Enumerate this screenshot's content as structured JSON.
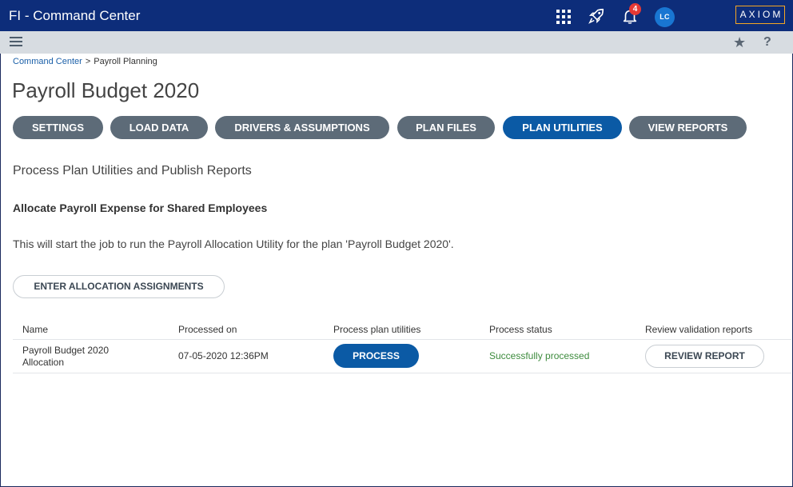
{
  "app": {
    "title": "FI - Command Center",
    "notification_count": "4",
    "user_initials": "LC",
    "logo": "AXIOM",
    "icons": [
      "apps-grid-icon",
      "rocket-icon",
      "bell-icon",
      "hamburger-menu-icon",
      "star-icon",
      "help-icon"
    ]
  },
  "breadcrumb": {
    "items": [
      "Command Center",
      "Payroll Planning"
    ],
    "separator": ">"
  },
  "page": {
    "title": "Payroll Budget 2020"
  },
  "tabs": [
    {
      "label": "SETTINGS",
      "active": false
    },
    {
      "label": "LOAD DATA",
      "active": false
    },
    {
      "label": "DRIVERS & ASSUMPTIONS",
      "active": false
    },
    {
      "label": "PLAN FILES",
      "active": false
    },
    {
      "label": "PLAN UTILITIES",
      "active": true
    },
    {
      "label": "VIEW REPORTS",
      "active": false
    }
  ],
  "content": {
    "section_title": "Process Plan Utilities and Publish Reports",
    "sub_heading": "Allocate Payroll Expense for Shared Employees",
    "description": "This will start the job to run the Payroll Allocation Utility for the plan 'Payroll Budget 2020'.",
    "enter_button": "ENTER ALLOCATION ASSIGNMENTS"
  },
  "table": {
    "columns": [
      "Name",
      "Processed on",
      "Process plan utilities",
      "Process status",
      "Review validation reports"
    ],
    "rows": [
      {
        "name": "Payroll Budget 2020 Allocation",
        "processed_on": "07-05-2020 12:36PM",
        "process_button": "PROCESS",
        "status": "Successfully processed",
        "review_button": "REVIEW REPORT"
      }
    ]
  },
  "colors": {
    "topbar": "#0d2d7a",
    "tab_default": "#5d6b78",
    "tab_active": "#0b5aa5",
    "status_success": "#3d8b3d",
    "badge": "#e53935",
    "logo_border": "#f5a623"
  }
}
